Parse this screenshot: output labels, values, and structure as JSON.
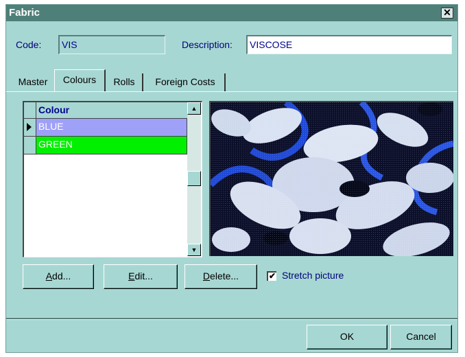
{
  "window": {
    "title": "Fabric",
    "close_glyph": "✕"
  },
  "code": {
    "label": "Code:",
    "value": "VIS"
  },
  "description": {
    "label": "Description:",
    "value": "VISCOSE"
  },
  "tabs": [
    {
      "label": "Master"
    },
    {
      "label": "Colours"
    },
    {
      "label": "Rolls"
    },
    {
      "label": "Foreign Costs"
    }
  ],
  "colour_grid": {
    "header": "Colour",
    "rows": [
      {
        "name": "BLUE",
        "color": "#9fa0f8",
        "selected": true
      },
      {
        "name": "GREEN",
        "color": "#00f000",
        "selected": false
      }
    ]
  },
  "buttons": {
    "add": {
      "underline": "A",
      "rest": "dd..."
    },
    "edit": {
      "underline": "E",
      "rest": "dit..."
    },
    "delete": {
      "underline": "D",
      "rest": "elete..."
    },
    "ok": "OK",
    "cancel": "Cancel"
  },
  "stretch_picture": {
    "label": "Stretch picture",
    "checked": true,
    "check_glyph": "✔"
  },
  "colors": {
    "dialog_bg": "#a7d7d3",
    "titlebar": "#4f7f79",
    "label_text": "#00007a"
  }
}
